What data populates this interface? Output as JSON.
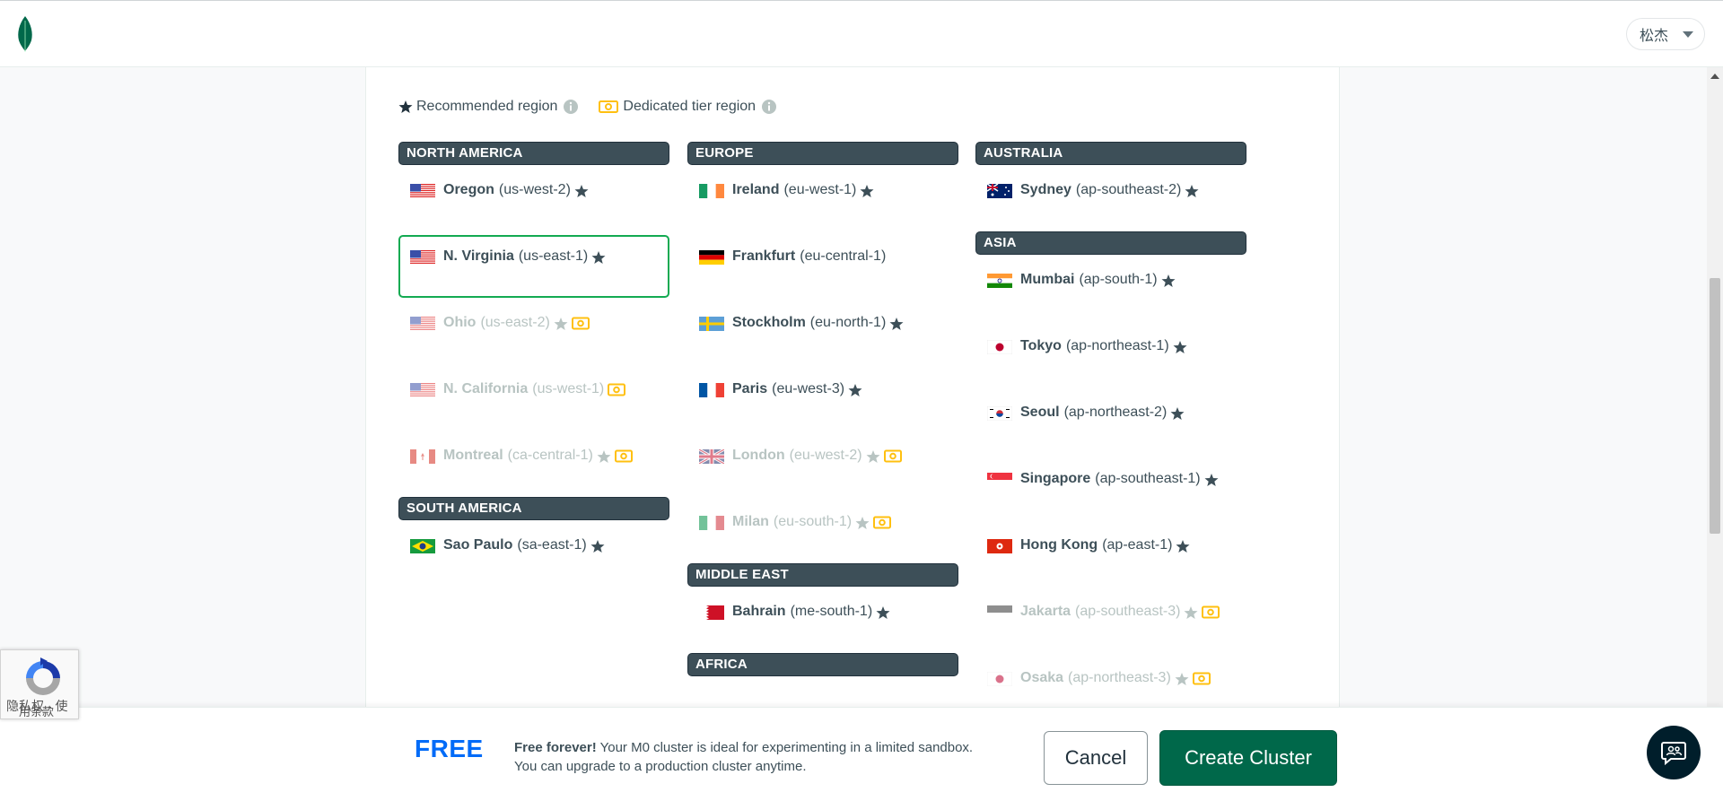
{
  "header": {
    "user_name": "松杰",
    "logo_icon": "mongodb-leaf-icon"
  },
  "legend": {
    "recommended_label": "Recommended region",
    "dedicated_label": "Dedicated tier region"
  },
  "columns": [
    {
      "groups": [
        {
          "title": "NORTH AMERICA",
          "regions": [
            {
              "name": "Oregon",
              "code": "(us-west-2)",
              "flag": "us",
              "recommended": true,
              "dedicated": false,
              "disabled": false,
              "selected": false
            },
            {
              "name": "N. Virginia",
              "code": "(us-east-1)",
              "flag": "us",
              "recommended": true,
              "dedicated": false,
              "disabled": false,
              "selected": true
            },
            {
              "name": "Ohio",
              "code": "(us-east-2)",
              "flag": "us",
              "recommended": true,
              "dedicated": true,
              "disabled": true,
              "selected": false
            },
            {
              "name": "N. California",
              "code": "(us-west-1)",
              "flag": "us",
              "recommended": false,
              "dedicated": true,
              "disabled": true,
              "selected": false
            },
            {
              "name": "Montreal",
              "code": "(ca-central-1)",
              "flag": "ca",
              "recommended": true,
              "dedicated": true,
              "disabled": true,
              "selected": false
            }
          ]
        },
        {
          "title": "SOUTH AMERICA",
          "regions": [
            {
              "name": "Sao Paulo",
              "code": "(sa-east-1)",
              "flag": "br",
              "recommended": true,
              "dedicated": false,
              "disabled": false,
              "selected": false
            }
          ]
        }
      ]
    },
    {
      "groups": [
        {
          "title": "EUROPE",
          "regions": [
            {
              "name": "Ireland",
              "code": "(eu-west-1)",
              "flag": "ie",
              "recommended": true,
              "dedicated": false,
              "disabled": false,
              "selected": false
            },
            {
              "name": "Frankfurt",
              "code": "(eu-central-1)",
              "flag": "de",
              "recommended": false,
              "dedicated": false,
              "disabled": false,
              "selected": false
            },
            {
              "name": "Stockholm",
              "code": "(eu-north-1)",
              "flag": "se",
              "recommended": true,
              "dedicated": false,
              "disabled": false,
              "selected": false
            },
            {
              "name": "Paris",
              "code": "(eu-west-3)",
              "flag": "fr",
              "recommended": true,
              "dedicated": false,
              "disabled": false,
              "selected": false
            },
            {
              "name": "London",
              "code": "(eu-west-2)",
              "flag": "gb",
              "recommended": true,
              "dedicated": true,
              "disabled": true,
              "selected": false
            },
            {
              "name": "Milan",
              "code": "(eu-south-1)",
              "flag": "it",
              "recommended": true,
              "dedicated": true,
              "disabled": true,
              "selected": false
            }
          ]
        },
        {
          "title": "MIDDLE EAST",
          "regions": [
            {
              "name": "Bahrain",
              "code": "(me-south-1)",
              "flag": "bh",
              "recommended": true,
              "dedicated": false,
              "disabled": false,
              "selected": false
            }
          ]
        },
        {
          "title": "AFRICA",
          "regions": []
        }
      ]
    },
    {
      "groups": [
        {
          "title": "AUSTRALIA",
          "regions": [
            {
              "name": "Sydney",
              "code": "(ap-southeast-2)",
              "flag": "au",
              "recommended": true,
              "dedicated": false,
              "disabled": false,
              "selected": false
            }
          ]
        },
        {
          "title": "ASIA",
          "regions": [
            {
              "name": "Mumbai",
              "code": "(ap-south-1)",
              "flag": "in",
              "recommended": true,
              "dedicated": false,
              "disabled": false,
              "selected": false
            },
            {
              "name": "Tokyo",
              "code": "(ap-northeast-1)",
              "flag": "jp",
              "recommended": true,
              "dedicated": false,
              "disabled": false,
              "selected": false
            },
            {
              "name": "Seoul",
              "code": "(ap-northeast-2)",
              "flag": "kr",
              "recommended": true,
              "dedicated": false,
              "disabled": false,
              "selected": false
            },
            {
              "name": "Singapore",
              "code": "(ap-southeast-1)",
              "flag": "sg",
              "recommended": true,
              "dedicated": false,
              "disabled": false,
              "selected": false
            },
            {
              "name": "Hong Kong",
              "code": "(ap-east-1)",
              "flag": "hk",
              "recommended": true,
              "dedicated": false,
              "disabled": false,
              "selected": false
            },
            {
              "name": "Jakarta",
              "code": "(ap-southeast-3)",
              "flag": "id",
              "recommended": true,
              "dedicated": true,
              "disabled": true,
              "selected": false
            },
            {
              "name": "Osaka",
              "code": "(ap-northeast-3)",
              "flag": "jp",
              "recommended": true,
              "dedicated": true,
              "disabled": true,
              "selected": false
            }
          ]
        }
      ]
    }
  ],
  "footer": {
    "tier_label": "FREE",
    "desc_bold": "Free forever!",
    "desc_line1": " Your M0 cluster is ideal for experimenting in a limited sandbox.",
    "desc_line2": "You can upgrade to a production cluster anytime.",
    "cancel_label": "Cancel",
    "create_label": "Create Cluster"
  },
  "recaptcha": {
    "text_line1": "隐私权 - 使",
    "text_line2": "用条款"
  },
  "colors": {
    "accent_green": "#00684a",
    "selected_border": "#13aa52",
    "header_bg": "#3d4f58",
    "free_blue": "#016bf8",
    "dedicated_gold": "#ffc010"
  }
}
